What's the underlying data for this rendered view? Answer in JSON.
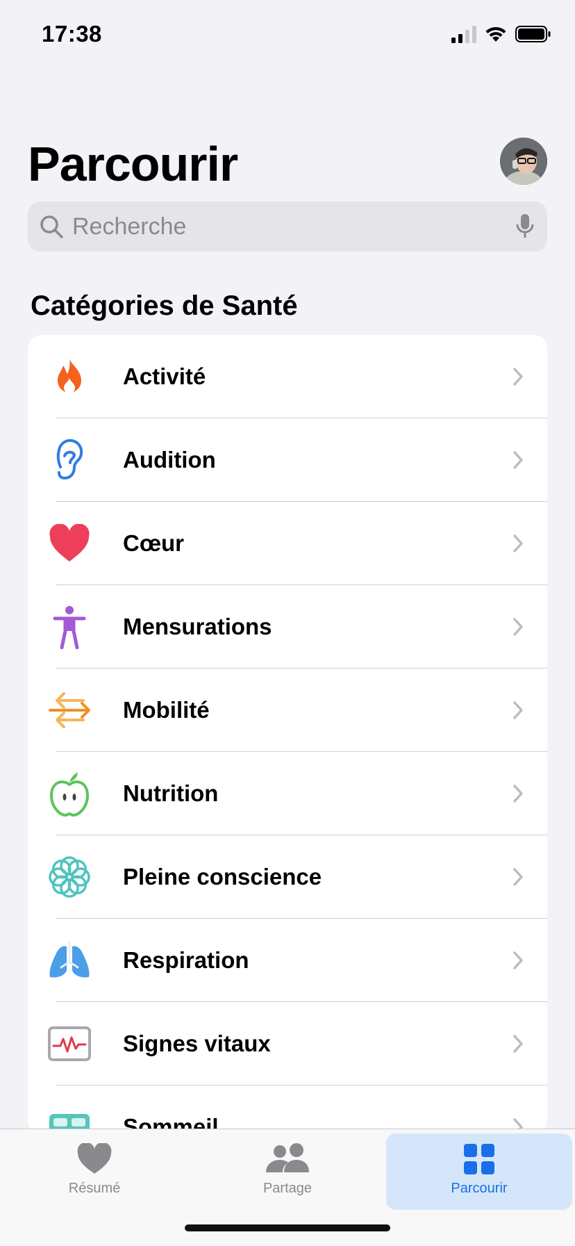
{
  "status": {
    "time": "17:38"
  },
  "header": {
    "title": "Parcourir"
  },
  "search": {
    "placeholder": "Recherche"
  },
  "section": {
    "title": "Catégories de Santé"
  },
  "categories": [
    {
      "label": "Activité",
      "icon": "flame-icon",
      "color": "#f5621e"
    },
    {
      "label": "Audition",
      "icon": "ear-icon",
      "color": "#2f7de1"
    },
    {
      "label": "Cœur",
      "icon": "heart-icon",
      "color": "#ee3f5a"
    },
    {
      "label": "Mensurations",
      "icon": "body-figure-icon",
      "color": "#a35ad4"
    },
    {
      "label": "Mobilité",
      "icon": "arrows-icon",
      "color": "#f1a03c"
    },
    {
      "label": "Nutrition",
      "icon": "apple-icon",
      "color": "#5ec25a"
    },
    {
      "label": "Pleine conscience",
      "icon": "mindfulness-flower-icon",
      "color": "#4fc4c0"
    },
    {
      "label": "Respiration",
      "icon": "lungs-icon",
      "color": "#4b9ee8"
    },
    {
      "label": "Signes vitaux",
      "icon": "vitals-monitor-icon",
      "color": "#e23a4a"
    },
    {
      "label": "Sommeil",
      "icon": "bed-icon",
      "color": "#56c5bd"
    }
  ],
  "tabs": [
    {
      "label": "Résumé",
      "icon": "heart-icon",
      "active": false
    },
    {
      "label": "Partage",
      "icon": "people-icon",
      "active": false
    },
    {
      "label": "Parcourir",
      "icon": "grid-icon",
      "active": true
    }
  ],
  "colors": {
    "accent": "#1a6fe8",
    "background": "#f2f2f7"
  }
}
